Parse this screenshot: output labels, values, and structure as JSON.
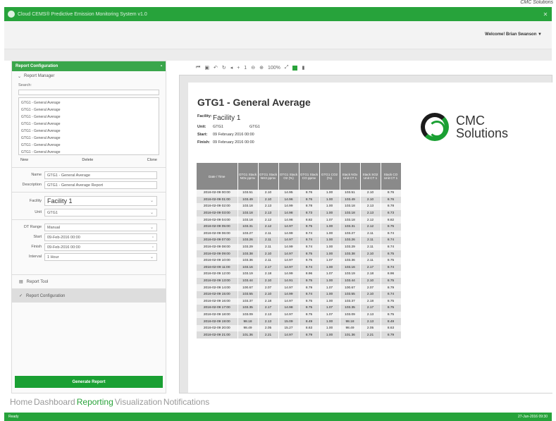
{
  "attribution": "CMC Solutions",
  "window": {
    "title": "Cloud CEMS® Predictive Emission Monitoring System v1.0"
  },
  "header": {
    "welcome": "Welcome! Brian Swanson ▼"
  },
  "left_panel": {
    "title": "Report Configuration",
    "section": "Report Manager",
    "search_label": "Search:",
    "reports": [
      "GTG1 - General Average",
      "GTG1 - General Average",
      "GTG1 - General Average",
      "GTG1 - General Average",
      "GTG1 - General Average",
      "GTG1 - General Average",
      "GTG1 - General Average",
      "GTG1 - General Average"
    ],
    "buttons": {
      "new": "New",
      "delete": "Delete",
      "clone": "Clone"
    },
    "fields": {
      "name_label": "Name",
      "name_value": "GTG1 - General Average",
      "description_label": "Description",
      "description_value": "GTG1 - General Average Report",
      "facility_label": "Facility",
      "facility_value": "Facility 1",
      "unit_label": "Unit",
      "unit_value": "GTG1",
      "dt_range_label": "DT Range",
      "dt_range_value": "Manual",
      "start_label": "Start",
      "start_value": "09-Feb-2016 00:00",
      "finish_label": "Finish",
      "finish_value": "09-Feb-2016 00:00",
      "interval_label": "Interval",
      "interval_value": "1 Hour"
    },
    "nav": {
      "report_tool": "Report Tool",
      "report_configuration": "Report Configuration"
    },
    "generate": "Generate Report"
  },
  "toolbar": {
    "zoom": "100%"
  },
  "report": {
    "title": "GTG1 - General Average",
    "facility_label": "Facility:",
    "facility": "Facility 1",
    "unit_label": "Unit:",
    "unit": "GTG1",
    "unit2": "GTG1",
    "start_label": "Start:",
    "start": "09 February 2016 00:00",
    "finish_label": "Finish:",
    "finish": "09 February 2016 00:00",
    "logo_line1": "CMC",
    "logo_line2": "Solutions",
    "columns": [
      "Date / Time",
      "GTG1 Stack NOx ppmv",
      "GTG1 Stack NH3 ppmv",
      "GTG1 Stack O2 (%)",
      "GTG1 Stack CO ppmv",
      "GTG1 CO2 (%)",
      "Stack NOx Unit CT 1",
      "Stack SO2 Unit CT 1",
      "Stack CO Unit CT 1"
    ],
    "rows": [
      [
        "2016-02-09 00:00",
        "103.51",
        "2.10",
        "14.95",
        "8.76",
        "1.00",
        "103.51",
        "2.10",
        "8.76"
      ],
      [
        "2016-02-09 01:00",
        "103.49",
        "2.10",
        "14.96",
        "8.76",
        "1.00",
        "103.49",
        "2.10",
        "8.76"
      ],
      [
        "2016-02-09 02:00",
        "103.18",
        "2.13",
        "14.99",
        "8.78",
        "1.00",
        "103.18",
        "2.13",
        "8.78"
      ],
      [
        "2016-02-09 03:00",
        "103.18",
        "2.13",
        "14.98",
        "8.73",
        "1.00",
        "103.18",
        "2.13",
        "8.73"
      ],
      [
        "2016-02-09 04:00",
        "103.18",
        "2.12",
        "14.98",
        "8.82",
        "1.07",
        "103.18",
        "2.12",
        "8.82"
      ],
      [
        "2016-02-09 05:00",
        "103.31",
        "2.12",
        "14.97",
        "8.75",
        "1.00",
        "103.31",
        "2.12",
        "8.75"
      ],
      [
        "2016-02-09 06:00",
        "103.27",
        "2.11",
        "14.99",
        "8.74",
        "1.00",
        "103.27",
        "2.11",
        "8.74"
      ],
      [
        "2016-02-09 07:00",
        "103.26",
        "2.11",
        "14.97",
        "8.74",
        "1.00",
        "103.26",
        "2.11",
        "8.74"
      ],
      [
        "2016-02-09 08:00",
        "103.29",
        "2.11",
        "14.99",
        "8.74",
        "1.00",
        "103.29",
        "2.11",
        "8.74"
      ],
      [
        "2016-02-09 09:00",
        "103.38",
        "2.10",
        "14.97",
        "8.75",
        "1.00",
        "103.38",
        "2.10",
        "8.75"
      ],
      [
        "2016-02-09 10:00",
        "103.36",
        "2.11",
        "14.97",
        "8.75",
        "1.07",
        "103.36",
        "2.11",
        "8.75"
      ],
      [
        "2016-02-09 11:00",
        "103.16",
        "2.17",
        "14.97",
        "8.74",
        "1.00",
        "103.16",
        "2.17",
        "8.74"
      ],
      [
        "2016-02-09 12:00",
        "103.19",
        "2.18",
        "14.99",
        "8.96",
        "1.07",
        "103.19",
        "2.18",
        "8.96"
      ],
      [
        "2016-02-09 13:00",
        "103.44",
        "2.10",
        "14.91",
        "8.75",
        "1.00",
        "103.44",
        "2.10",
        "8.75"
      ],
      [
        "2016-02-09 14:00",
        "100.67",
        "2.07",
        "14.97",
        "8.79",
        "1.07",
        "100.67",
        "2.07",
        "8.79"
      ],
      [
        "2016-02-09 15:00",
        "103.55",
        "2.10",
        "14.99",
        "8.74",
        "1.00",
        "103.55",
        "2.10",
        "8.74"
      ],
      [
        "2016-02-09 16:00",
        "103.37",
        "2.18",
        "14.97",
        "8.75",
        "1.00",
        "103.37",
        "2.18",
        "8.75"
      ],
      [
        "2016-02-09 17:00",
        "103.35",
        "2.17",
        "14.98",
        "8.75",
        "1.07",
        "103.35",
        "2.17",
        "8.75"
      ],
      [
        "2016-02-09 18:00",
        "103.09",
        "2.13",
        "14.97",
        "8.75",
        "1.07",
        "103.09",
        "2.13",
        "8.75"
      ],
      [
        "2016-02-09 19:00",
        "98.18",
        "2.13",
        "15.09",
        "8.49",
        "1.00",
        "98.18",
        "2.13",
        "8.49"
      ],
      [
        "2016-02-09 20:00",
        "98.49",
        "2.05",
        "15.27",
        "8.63",
        "1.00",
        "98.49",
        "2.05",
        "8.63"
      ],
      [
        "2016-02-09 21:00",
        "101.36",
        "2.21",
        "14.97",
        "8.79",
        "1.00",
        "101.36",
        "2.21",
        "8.79"
      ]
    ]
  },
  "bottom_nav": [
    "Home",
    "Dashboard",
    "Reporting",
    "Visualization",
    "Notifications"
  ],
  "status": {
    "left": "Ready",
    "right": "27-Jun-2016 09:30"
  }
}
